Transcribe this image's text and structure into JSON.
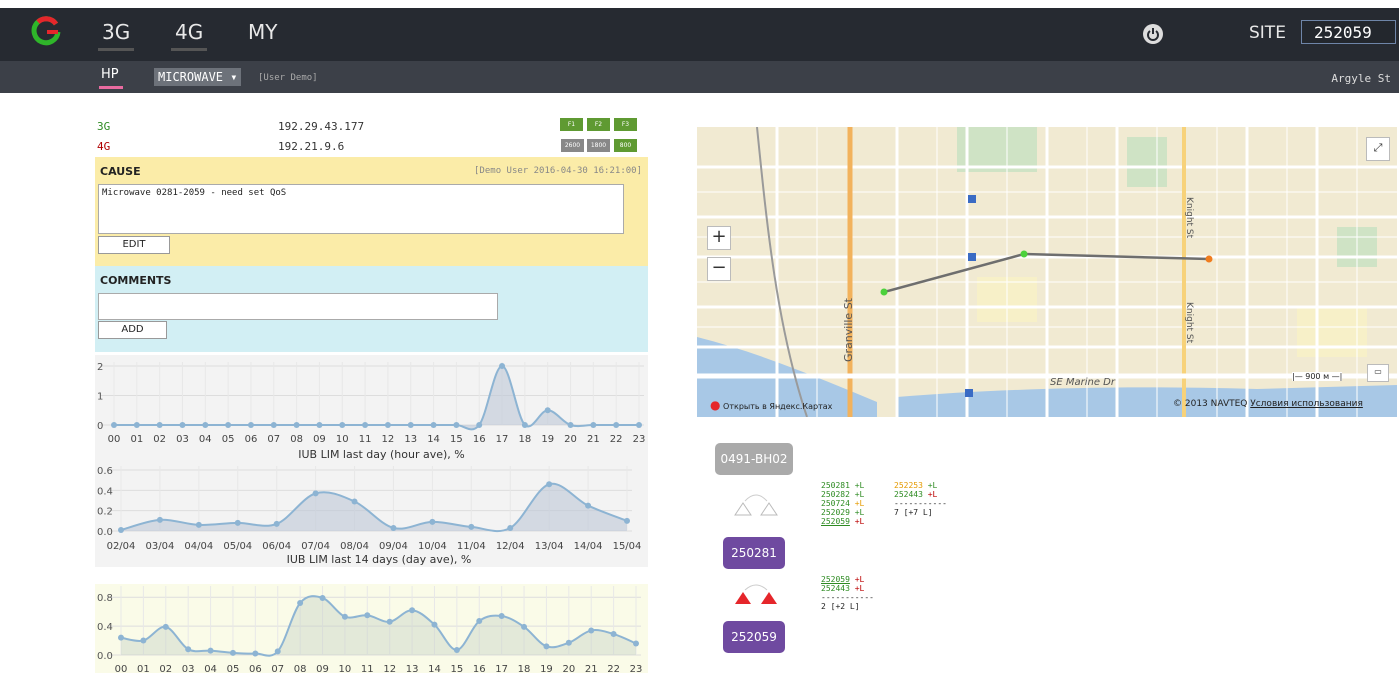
{
  "header": {
    "tabs": [
      "3G",
      "4G",
      "MY"
    ],
    "site_label": "SITE",
    "site_value": "252059",
    "subtabs": {
      "hp": "HP",
      "microwave": "MICROWAVE",
      "user_demo": "[User Demo]"
    },
    "street": "Argyle St"
  },
  "ips": [
    {
      "tech": "3G",
      "ip": "192.29.43.177",
      "color": "#2e8b22"
    },
    {
      "tech": "4G",
      "ip": "192.21.9.6",
      "color": "#b00000"
    }
  ],
  "band_buttons_3g": [
    "F1",
    "F2",
    "F3"
  ],
  "band_buttons_4g": [
    "2600",
    "1800",
    "800"
  ],
  "cause": {
    "title": "CAUSE",
    "meta": "[Demo User 2016-04-30 16:21:00]",
    "text": "Microwave 0281-2059 - need set QoS",
    "edit_label": "EDIT"
  },
  "comments": {
    "title": "COMMENTS",
    "add_label": "ADD"
  },
  "chart_data": [
    {
      "type": "line",
      "title": "IUB LIM last day (hour ave), %",
      "categories": [
        "00",
        "01",
        "02",
        "03",
        "04",
        "05",
        "06",
        "07",
        "08",
        "09",
        "10",
        "11",
        "12",
        "13",
        "14",
        "15",
        "16",
        "17",
        "18",
        "19",
        "20",
        "21",
        "22",
        "23"
      ],
      "values": [
        0,
        0,
        0,
        0,
        0,
        0,
        0,
        0,
        0,
        0,
        0,
        0,
        0,
        0,
        0,
        0,
        0,
        2,
        0,
        0.5,
        0,
        0,
        0,
        0
      ],
      "ylim": [
        0,
        2
      ],
      "yticks": [
        "2",
        "1",
        "0"
      ]
    },
    {
      "type": "area",
      "title": "IUB LIM last 14 days (day ave), %",
      "categories": [
        "02/04",
        "03/04",
        "04/04",
        "05/04",
        "06/04",
        "07/04",
        "08/04",
        "09/04",
        "10/04",
        "11/04",
        "12/04",
        "13/04",
        "14/04",
        "15/04"
      ],
      "values": [
        0.01,
        0.11,
        0.06,
        0.08,
        0.07,
        0.37,
        0.29,
        0.03,
        0.09,
        0.04,
        0.03,
        0.46,
        0.25,
        0.1
      ],
      "ylim": [
        0,
        0.6
      ],
      "yticks": [
        "0.6",
        "0.4",
        "0.2",
        "0.0"
      ]
    },
    {
      "type": "area",
      "title": "",
      "categories": [
        "00",
        "01",
        "02",
        "03",
        "04",
        "05",
        "06",
        "07",
        "08",
        "09",
        "10",
        "11",
        "12",
        "13",
        "14",
        "15",
        "16",
        "17",
        "18",
        "19",
        "20",
        "21",
        "22",
        "23"
      ],
      "values": [
        0.24,
        0.2,
        0.39,
        0.08,
        0.06,
        0.03,
        0.02,
        0.05,
        0.72,
        0.79,
        0.53,
        0.55,
        0.46,
        0.62,
        0.42,
        0.07,
        0.47,
        0.54,
        0.39,
        0.12,
        0.17,
        0.34,
        0.29,
        0.16
      ],
      "ylim": [
        0,
        0.9
      ],
      "yticks": [
        "0.8",
        "0.4",
        "0.0"
      ]
    }
  ],
  "map": {
    "streets": [
      "Granville St",
      "Knight St",
      "SE Marine Dr"
    ],
    "open_link": "Открыть в Яндекс.Картах",
    "copyright": "© 2013 NAVTEQ",
    "terms": "Условия использования",
    "scale": "900 м"
  },
  "link_panel": {
    "node_label": "0491-BH02",
    "site1": "250281",
    "site2": "252059",
    "list1_left": [
      {
        "id": "250281",
        "suffix": "+L",
        "color": "green"
      },
      {
        "id": "250282",
        "suffix": "+L",
        "color": "green"
      },
      {
        "id": "250724",
        "suffix": "+L",
        "color": "green"
      },
      {
        "id": "252029",
        "suffix": "+L",
        "color": "green"
      },
      {
        "id": "252059",
        "suffix": "+L",
        "color": "green"
      }
    ],
    "list1_right": [
      {
        "id": "252253",
        "suffix": "+L",
        "color": "orange"
      },
      {
        "id": "252443",
        "suffix": "+L",
        "color": "green"
      }
    ],
    "list1_sep": "-----------",
    "list1_total": "7 [+7 L]",
    "list2": [
      {
        "id": "252059",
        "suffix": "+L",
        "color": "green"
      },
      {
        "id": "252443",
        "suffix": "+L",
        "color": "green"
      }
    ],
    "list2_sep": "-----------",
    "list2_total": "2 [+2 L]"
  }
}
